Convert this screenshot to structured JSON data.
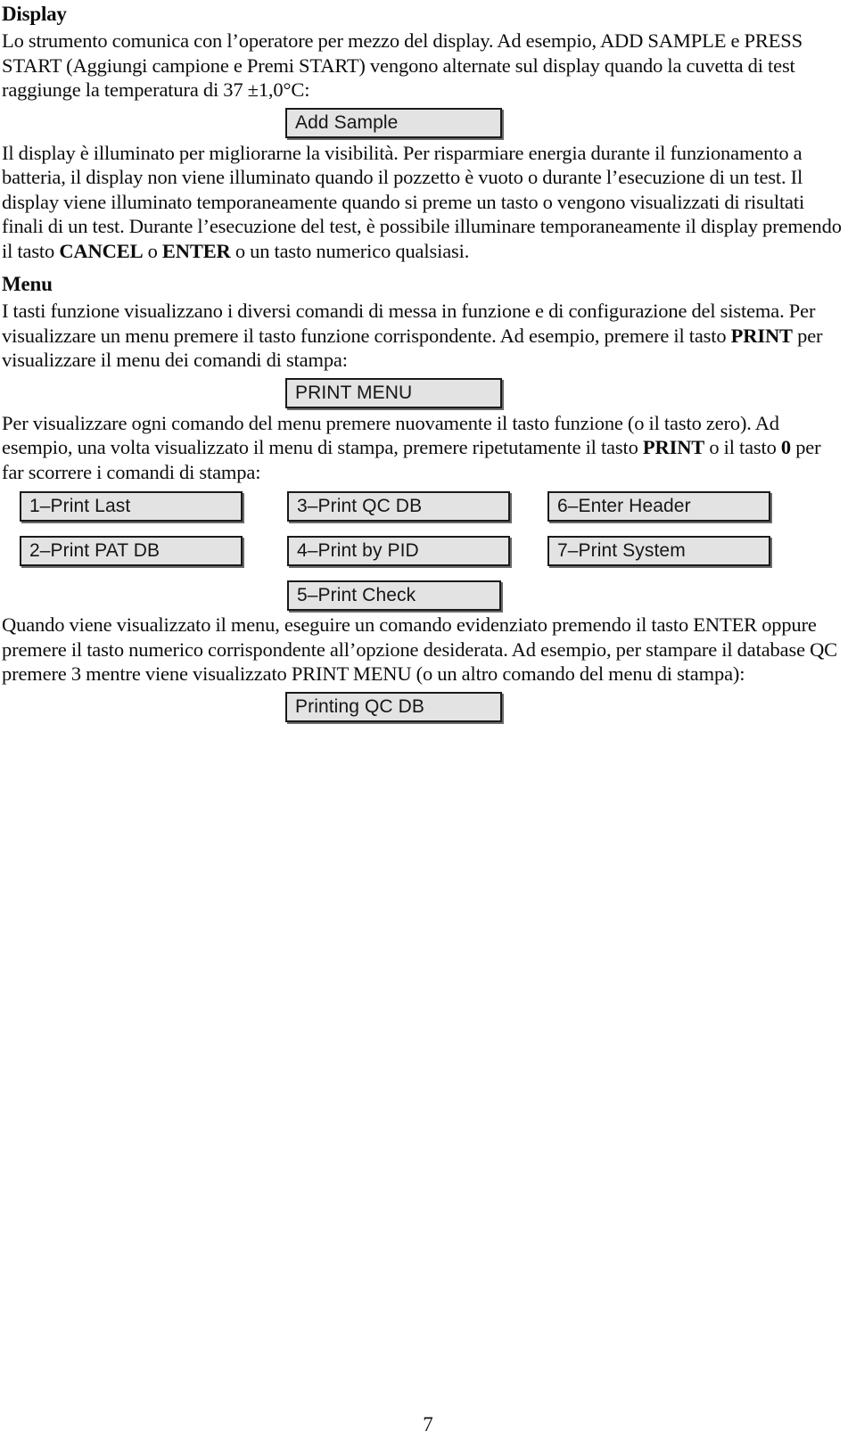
{
  "document": {
    "page_number": "7",
    "language": "it"
  },
  "sections": {
    "display": {
      "heading": "Display",
      "intro_part1": "Lo strumento comunica con l’operatore per mezzo del display. Ad esempio, ADD SAMPLE e PRESS START (Aggiungi campione e Premi START) vengono alternate sul display quando la cuvetta di test raggiunge la temperatura di 37 ",
      "intro_temp": "±1,0°C:",
      "lcd_add_sample": "Add Sample",
      "body_part1": "Il display è illuminato per migliorarne la visibilità. Per risparmiare energia durante il funzionamento a batteria, il display non viene illuminato quando il pozzetto è vuoto o durante l’esecuzione di un test. Il display viene illuminato temporaneamente quando si preme un tasto o vengono visualizzati di risultati finali di un test. Durante l’esecuzione del test, è possibile illuminare temporaneamente il display premendo il tasto ",
      "body_bold1": "CANCEL",
      "body_part2": " o ",
      "body_bold2": "ENTER",
      "body_part3": " o un tasto numerico qualsiasi."
    },
    "menu": {
      "heading": "Menu",
      "intro_part1": "I tasti funzione visualizzano i diversi comandi di messa in funzione e di configurazione del sistema. Per visualizzare un menu premere il tasto funzione corrispondente. Ad esempio, premere il tasto ",
      "intro_bold1": "PRINT",
      "intro_part2": " per visualizzare il menu dei comandi di stampa:",
      "lcd_print_menu": "PRINT MENU",
      "body_part1": "Per visualizzare ogni comando del menu premere nuovamente il tasto funzione (o il tasto zero). Ad esempio, una volta visualizzato il menu di stampa, premere ripetutamente il tasto ",
      "body_bold1": "PRINT",
      "body_part2": " o il tasto ",
      "body_bold2": "0",
      "body_part3": " per far scorrere i comandi di stampa:",
      "items": [
        {
          "label": "1–Print Last"
        },
        {
          "label": "3–Print QC DB"
        },
        {
          "label": "6–Enter Header"
        },
        {
          "label": "2–Print PAT DB"
        },
        {
          "label": "4–Print by PID"
        },
        {
          "label": "7–Print System"
        },
        {
          "label": "5–Print Check"
        }
      ],
      "closing_text": "Quando viene visualizzato il menu, eseguire un comando evidenziato premendo il tasto ENTER oppure premere il tasto numerico corrispondente all’opzione desiderata. Ad esempio, per stampare il database QC premere 3 mentre viene visualizzato PRINT MENU (o un altro comando del menu di stampa):",
      "lcd_printing_qc_db": "Printing QC DB"
    }
  },
  "colors": {
    "lcd_fill": "#e3e3e3",
    "lcd_border": "#1a1a1a",
    "lcd_shadow": "#6b6b6b",
    "text": "#0d0d0d"
  }
}
